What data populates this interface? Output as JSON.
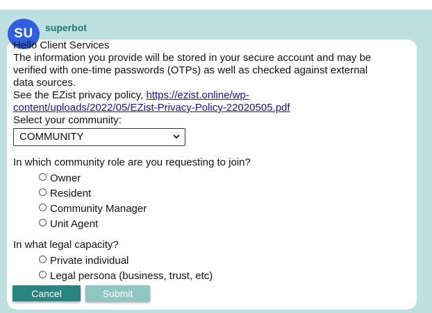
{
  "bot": {
    "avatar_initials": "SU",
    "name": "superbot",
    "avatar_color": "#2f5fe0"
  },
  "message": {
    "greeting": "Hello Client Services",
    "info_lines": [
      "The information you provide will be stored in your secure account and may be",
      "verified with one-time passwords (OTPs) as well as checked against external",
      "data sources."
    ],
    "privacy_prefix": "See the EZist privacy policy, ",
    "privacy_link_line1": "https://ezist.online/wp-",
    "privacy_link_line2": "content/uploads/2022/05/EZist-Privacy-Policy-22020505.pdf",
    "community_label": "Select your community:",
    "community_selected": "COMMUNITY"
  },
  "role_question": {
    "label": "In which community role are you requesting to join?",
    "options": [
      "Owner",
      "Resident",
      "Community Manager",
      "Unit Agent"
    ]
  },
  "legal_question": {
    "label": "In what legal capacity?",
    "options": [
      "Private individual",
      "Legal persona (business, trust, etc)"
    ]
  },
  "actions": {
    "cancel_label": "Cancel",
    "submit_label": "Submit"
  },
  "colors": {
    "chat_background": "#bfe0e0",
    "bot_name": "#1c7c6e",
    "cancel_button": "#2a8580",
    "submit_button_disabled": "#8fc7c3",
    "link": "#1a0dab"
  }
}
